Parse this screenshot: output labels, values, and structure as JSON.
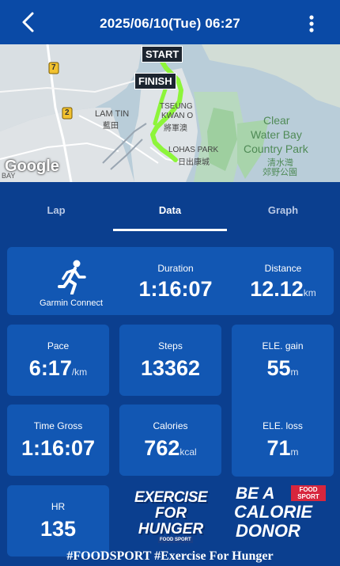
{
  "header": {
    "datetime": "2025/06/10(Tue) 06:27",
    "back_icon": "chevron-left-icon",
    "menu_icon": "more-vertical-icon"
  },
  "map": {
    "start_label": "START",
    "finish_label": "FINISH",
    "places": {
      "lam_tin_en": "LAM TIN",
      "lam_tin_zh": "藍田",
      "tko_en1": "TSEUNG",
      "tko_en2": "KWAN O",
      "tko_zh": "將軍澳",
      "lohas_en": "LOHAS PARK",
      "lohas_zh": "日出康城",
      "cwb_1": "Clear",
      "cwb_2": "Water Bay",
      "cwb_3": "Country Park",
      "cwb_zh1": "清水灣",
      "cwb_zh2": "郊野公園",
      "bay": "BAY"
    },
    "routes": {
      "r7": "7",
      "r2": "2"
    },
    "attribution": "Google",
    "route_color": "#8df53a"
  },
  "tabs": [
    {
      "label": "Lap",
      "active": false
    },
    {
      "label": "Data",
      "active": true
    },
    {
      "label": "Graph",
      "active": false
    }
  ],
  "source": {
    "label": "Garmin Connect",
    "icon": "running-person-icon"
  },
  "stats": {
    "duration": {
      "label": "Duration",
      "value": "1:16:07"
    },
    "distance": {
      "label": "Distance",
      "value": "12.12",
      "unit": "km"
    },
    "pace": {
      "label": "Pace",
      "value": "6:17",
      "unit": "/km"
    },
    "steps": {
      "label": "Steps",
      "value": "13362"
    },
    "ele_gain": {
      "label": "ELE. gain",
      "value": "55",
      "unit": "m"
    },
    "time_gross": {
      "label": "Time Gross",
      "value": "1:16:07"
    },
    "calories": {
      "label": "Calories",
      "value": "762",
      "unit": "kcal"
    },
    "ele_loss": {
      "label": "ELE. loss",
      "value": "71",
      "unit": "m"
    },
    "hr": {
      "label": "HR",
      "value": "135"
    }
  },
  "promo": {
    "exercise_line1": "EXERCISE",
    "exercise_line2": "FOR",
    "exercise_line3": "HUNGER",
    "exercise_logo": "FOOD SPORT",
    "donor_line1": "BE A",
    "donor_line2": "CALORIE",
    "donor_line3": "DONOR",
    "donor_logo": "FOOD SPORT"
  },
  "hashtag": "#FOODSPORT #Exercise For Hunger",
  "colors": {
    "background": "#0b3f8f",
    "card": "#1257b3",
    "header": "#0a4aa6"
  }
}
